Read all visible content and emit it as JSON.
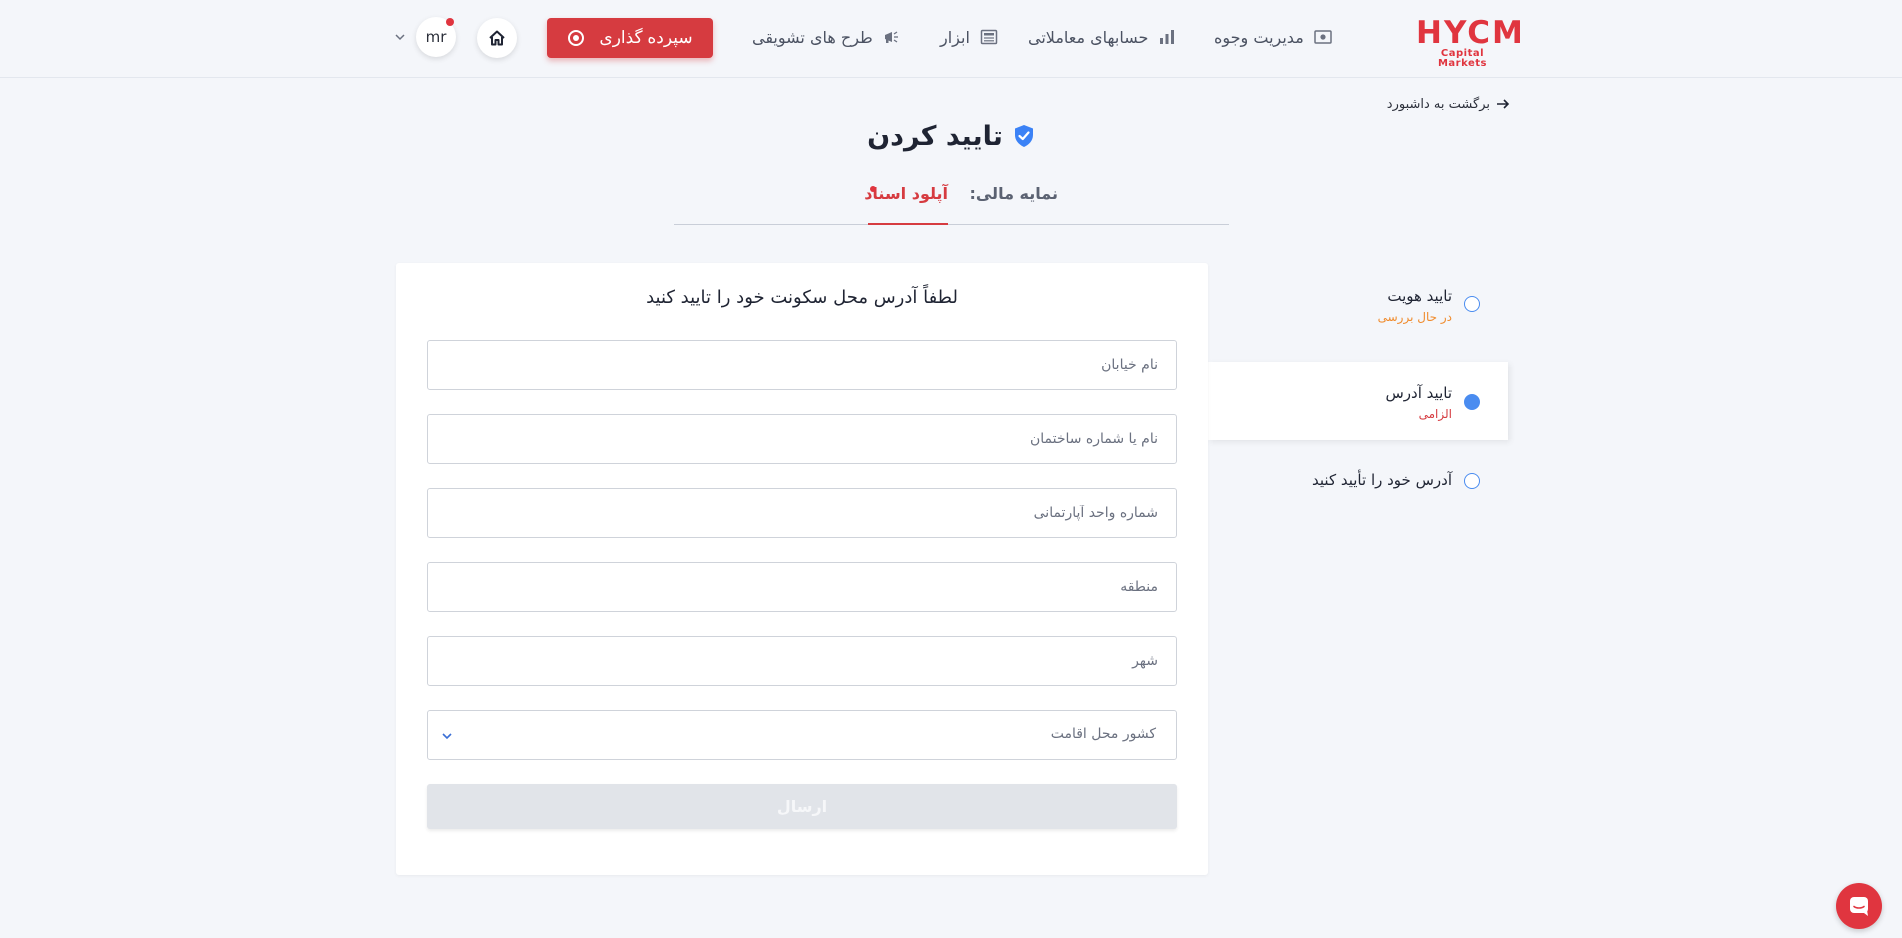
{
  "brand": {
    "logo_main": "HYCM",
    "logo_sub": "Capital Markets",
    "accent": "#e0353f"
  },
  "nav": {
    "funds": "مدیریت وجوه",
    "accounts": "حسابهای معاملاتی",
    "tools": "ابزار",
    "promos": "طرح های تشویقی",
    "deposit": "سپرده گذاری",
    "avatar": "mr"
  },
  "back_link": "برگشت به داشبورد",
  "page_title": "تایید کردن",
  "tabs": {
    "finance": "نمایه مالی:",
    "upload": "آپلود اسناد"
  },
  "steps": [
    {
      "title": "تایید هویت",
      "status": "در حال بررسی"
    },
    {
      "title": "تایید آدرس",
      "status": "الزامی"
    },
    {
      "title": "آدرس خود را تأیید کنید",
      "status": ""
    }
  ],
  "form": {
    "heading": "لطفاً آدرس محل سکونت خود را تایید کنید",
    "street": {
      "placeholder": "نام خیابان",
      "value": ""
    },
    "building": {
      "placeholder": "نام یا شماره ساختمان",
      "value": ""
    },
    "apartment": {
      "placeholder": "شماره واحد آپارتمانی",
      "value": ""
    },
    "region": {
      "placeholder": "منطقه",
      "value": ""
    },
    "city": {
      "placeholder": "شهر",
      "value": ""
    },
    "country": {
      "placeholder": "کشور محل اقامت"
    },
    "submit": "ارسال"
  }
}
